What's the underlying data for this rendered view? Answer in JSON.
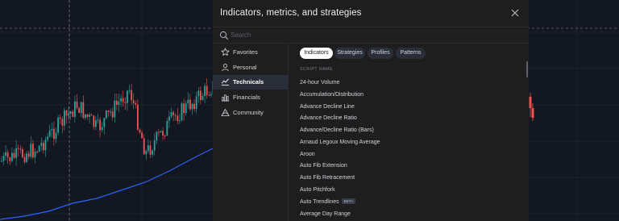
{
  "dialog": {
    "title": "Indicators, metrics, and strategies",
    "search_placeholder": "Search"
  },
  "sidebar": {
    "items": [
      {
        "label": "Favorites",
        "icon": "star-icon",
        "active": false
      },
      {
        "label": "Personal",
        "icon": "user-icon",
        "active": false
      },
      {
        "label": "Technicals",
        "icon": "chart-icon",
        "active": true
      },
      {
        "label": "Financials",
        "icon": "bar-chart-icon",
        "active": false
      },
      {
        "label": "Community",
        "icon": "community-icon",
        "active": false
      }
    ]
  },
  "tabs": [
    {
      "label": "Indicators",
      "active": true
    },
    {
      "label": "Strategies",
      "active": false
    },
    {
      "label": "Profiles",
      "active": false
    },
    {
      "label": "Patterns",
      "active": false
    }
  ],
  "list": {
    "column_header": "SCRIPT NAME",
    "items": [
      {
        "name": "24-hour Volume"
      },
      {
        "name": "Accumulation/Distribution"
      },
      {
        "name": "Advance Decline Line"
      },
      {
        "name": "Advance Decline Ratio"
      },
      {
        "name": "Advance/Decline Ratio (Bars)"
      },
      {
        "name": "Arnaud Legoux Moving Average"
      },
      {
        "name": "Aroon"
      },
      {
        "name": "Auto Fib Extension"
      },
      {
        "name": "Auto Fib Retracement"
      },
      {
        "name": "Auto Pitchfork"
      },
      {
        "name": "Auto Trendlines",
        "badge": "BETA"
      },
      {
        "name": "Average Day Range"
      }
    ]
  },
  "colors": {
    "chart_background": "#131722",
    "candle_up": "#26a69a",
    "candle_down": "#ef5350",
    "moving_average": "#2962ff",
    "dialog_background": "#1e1e1e"
  }
}
